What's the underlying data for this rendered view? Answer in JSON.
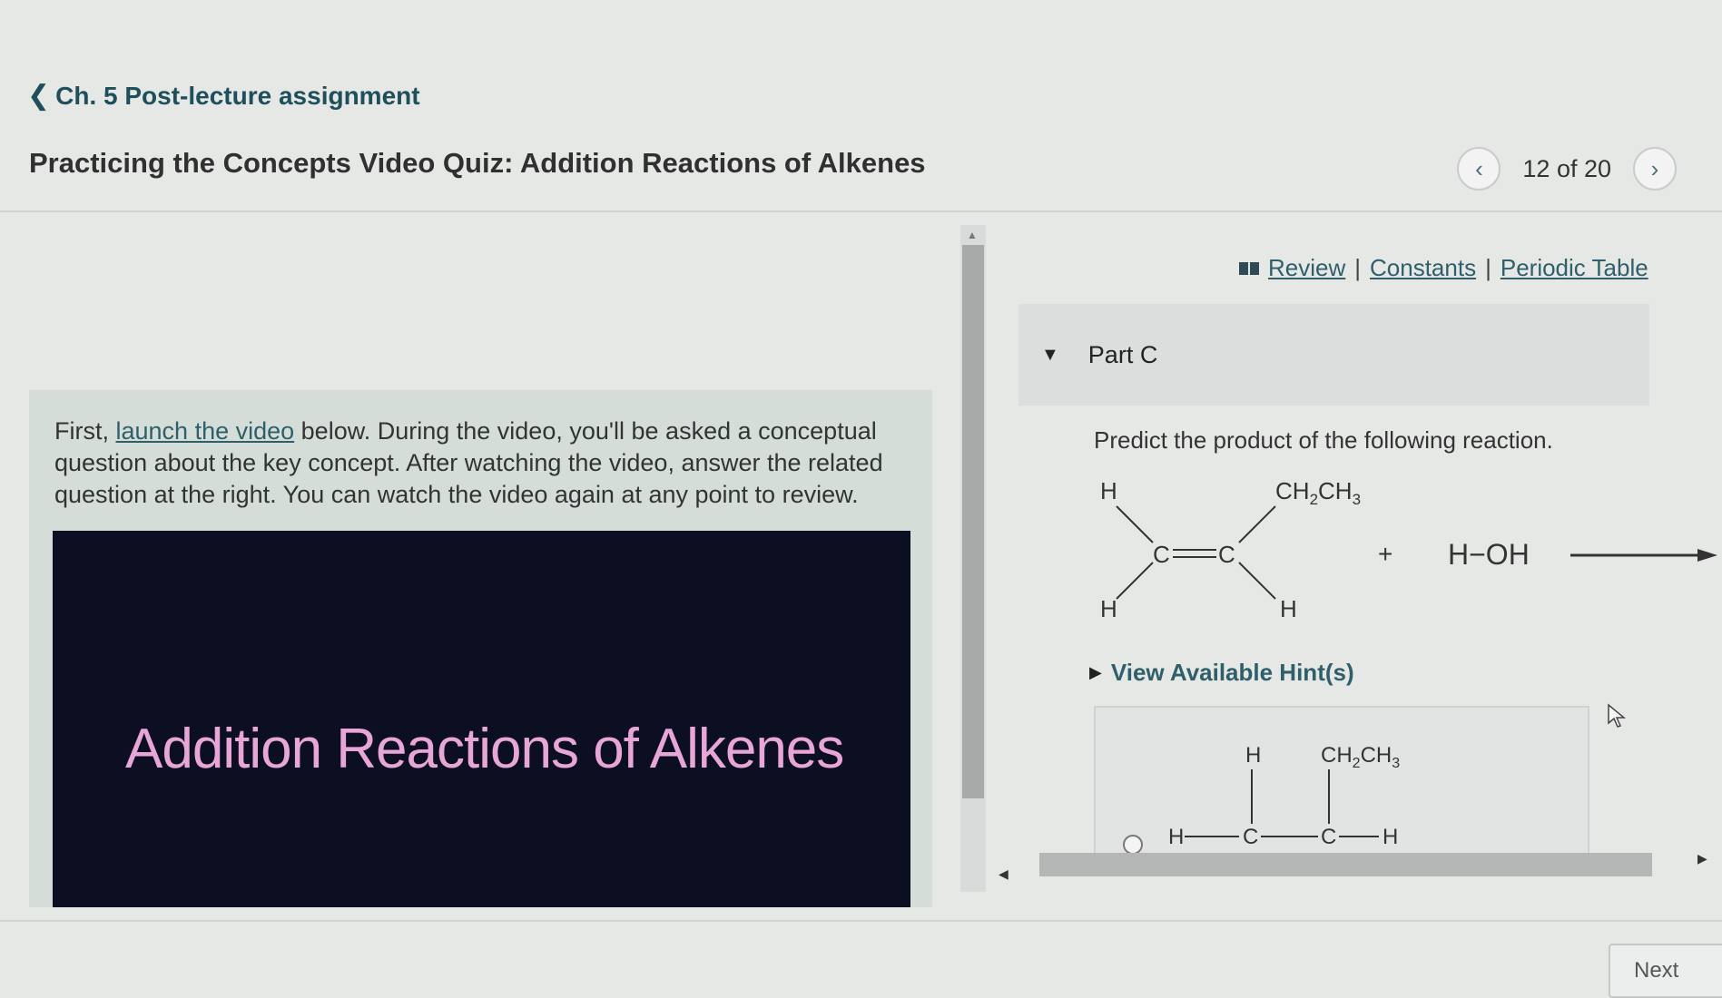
{
  "nav": {
    "back_label": "Ch. 5 Post-lecture assignment",
    "quiz_title": "Practicing the Concepts Video Quiz: Addition Reactions of Alkenes",
    "page_indicator": "12 of 20"
  },
  "left": {
    "intro_before": "First, ",
    "intro_link": "launch the video",
    "intro_after": " below. During the video, you'll be asked a conceptual question about the key concept. After watching the video, answer the related question at the right. You can watch the video again at any point to review.",
    "video_title": "Addition Reactions of Alkenes"
  },
  "resources": {
    "review": "Review",
    "constants": "Constants",
    "periodic_table": "Periodic Table",
    "separator": "|"
  },
  "part": {
    "label": "Part C",
    "question": "Predict the product of the following reaction."
  },
  "reaction": {
    "h_top_left": "H",
    "h_bottom_left": "H",
    "c1": "C",
    "c2": "C",
    "ethyl_top": "CH",
    "sub_2": "2",
    "ch3": "CH",
    "sub_3": "3",
    "h_bottom_right": "H",
    "plus": "+",
    "reagent": "H−OH"
  },
  "hints": {
    "label": "View Available Hint(s)"
  },
  "answer_option": {
    "h_top": "H",
    "ethyl": "CH",
    "h_left": "H",
    "c_a": "C",
    "c_b": "C",
    "h_right": "H"
  },
  "next_button": "Next"
}
